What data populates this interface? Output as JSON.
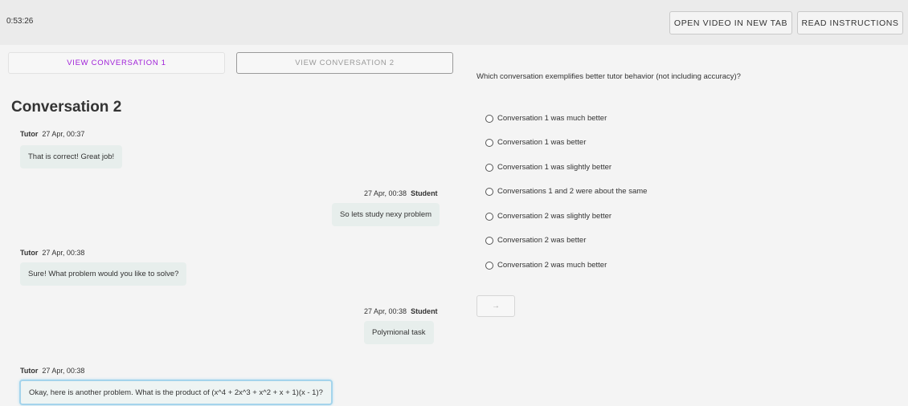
{
  "header": {
    "timer": "0:53:26",
    "open_video_label": "OPEN VIDEO IN NEW TAB",
    "read_instructions_label": "READ INSTRUCTIONS"
  },
  "tabs": {
    "conv1_label": "VIEW CONVERSATION 1",
    "conv2_label": "VIEW CONVERSATION 2"
  },
  "conversation": {
    "title": "Conversation 2",
    "messages": [
      {
        "sender": "Tutor",
        "time": "27 Apr, 00:37",
        "text": "That is correct! Great job!"
      },
      {
        "sender": "Student",
        "time": "27 Apr, 00:38",
        "text": "So lets study nexy problem"
      },
      {
        "sender": "Tutor",
        "time": "27 Apr, 00:38",
        "text": "Sure! What problem would you like to solve?"
      },
      {
        "sender": "Student",
        "time": "27 Apr, 00:38",
        "text": "Polymional task"
      },
      {
        "sender": "Tutor",
        "time": "27 Apr, 00:38",
        "text": "Okay, here is another problem. What is the product of (x^4 + 2x^3 + x^2 + x + 1)(x - 1)?"
      }
    ]
  },
  "survey": {
    "question": "Which conversation exemplifies better tutor behavior (not including accuracy)?",
    "options": [
      "Conversation 1 was much better",
      "Conversation 1 was better",
      "Conversation 1 was slightly better",
      "Conversations 1 and 2 were about the same",
      "Conversation 2 was slightly better",
      "Conversation 2 was better",
      "Conversation 2 was much better"
    ],
    "next_label": "→"
  },
  "colors": {
    "accent_purple": "#a020d8",
    "bubble_bg": "#e7eeec",
    "focus_border": "#a4d4ec"
  }
}
